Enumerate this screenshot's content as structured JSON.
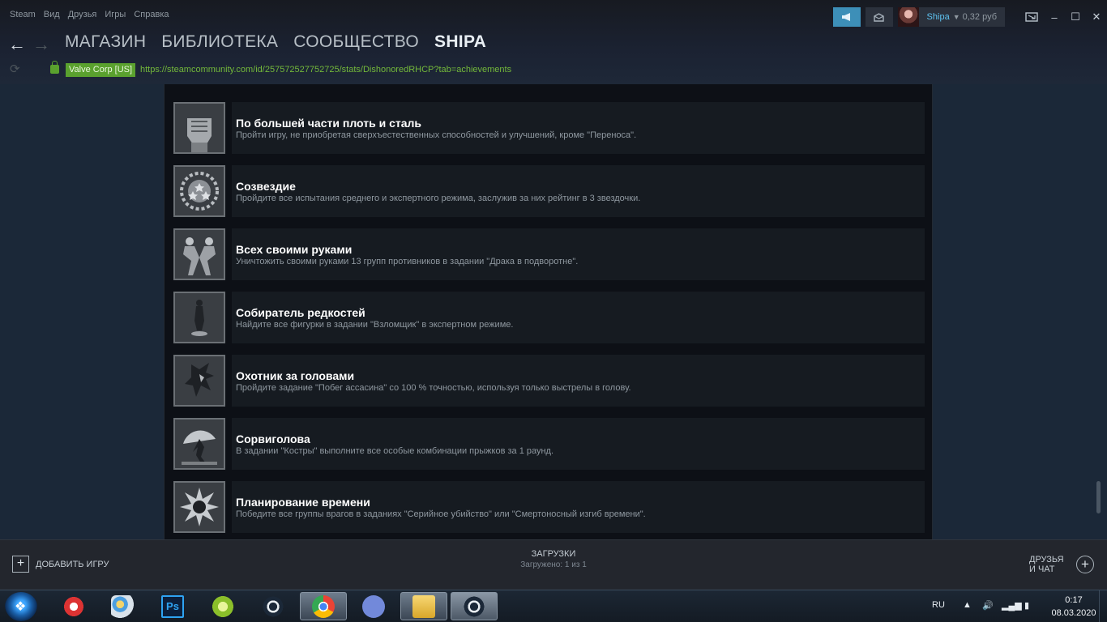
{
  "menubar": {
    "items": [
      "Steam",
      "Вид",
      "Друзья",
      "Игры",
      "Справка"
    ]
  },
  "topright": {
    "announce_icon": "megaphone-icon",
    "notify_icon": "envelope-icon",
    "account_name": "Shipa",
    "wallet": "0,32 руб",
    "big_picture_icon": "big-picture-icon",
    "window_controls": {
      "minimize": "–",
      "maximize": "☐",
      "close": "✕"
    }
  },
  "nav": {
    "back_glyph": "←",
    "forward_glyph": "→",
    "tabs": [
      "МАГАЗИН",
      "БИБЛИОТЕКА",
      "СООБЩЕСТВО",
      "SHIPA"
    ]
  },
  "url": {
    "reload_glyph": "⟳",
    "cert": "Valve Corp [US]",
    "address": "https://steamcommunity.com/id/257572527752725/stats/DishonoredRHCP?tab=achievements"
  },
  "achievements": [
    {
      "title": "По большей части плоть и сталь",
      "description": "Пройти игру, не приобретая сверхъестественных способностей и улучшений, кроме \"Переноса\".",
      "icon": "fist-icon"
    },
    {
      "title": "Созвездие",
      "description": "Пройдите все испытания среднего и экспертного режима, заслужив за них рейтинг в 3 звездочки.",
      "icon": "stars-wreath-icon"
    },
    {
      "title": "Всех своими руками",
      "description": "Уничтожить своими руками 13 групп противников в задании \"Драка в подворотне\".",
      "icon": "brawl-icon"
    },
    {
      "title": "Собиратель редкостей",
      "description": "Найдите все фигурки в задании \"Взломщик\" в экспертном режиме.",
      "icon": "figurine-icon"
    },
    {
      "title": "Охотник за головами",
      "description": "Пройдите задание \"Побег ассасина\" со 100 % точностью, используя только выстрелы в голову.",
      "icon": "assassin-icon"
    },
    {
      "title": "Сорвиголова",
      "description": "В задании \"Костры\" выполните все особые комбинации прыжков за 1 раунд.",
      "icon": "jumper-icon"
    },
    {
      "title": "Планирование времени",
      "description": "Победите все группы врагов в заданиях \"Серийное убийство\" или \"Смертоносный изгиб времени\".",
      "icon": "time-bend-icon"
    }
  ],
  "bottombar": {
    "add_game": "ДОБАВИТЬ ИГРУ",
    "downloads_title": "ЗАГРУЗКИ",
    "downloads_status": "Загружено: 1 из 1",
    "friends_line1": "ДРУЗЬЯ",
    "friends_line2": "И ЧАТ"
  },
  "taskbar": {
    "apps": [
      {
        "name": "ccleaner",
        "icon": "ccleaner-icon"
      },
      {
        "name": "paint",
        "icon": "paint-palette-icon"
      },
      {
        "name": "photoshop",
        "icon": "photoshop-icon",
        "label": "Ps"
      },
      {
        "name": "lime",
        "icon": "lime-icon"
      },
      {
        "name": "steam-pinned",
        "icon": "steam-icon"
      },
      {
        "name": "chrome",
        "icon": "chrome-icon"
      },
      {
        "name": "discord",
        "icon": "discord-icon"
      },
      {
        "name": "explorer",
        "icon": "folder-icon"
      },
      {
        "name": "steam-active",
        "icon": "steam-icon"
      }
    ],
    "language": "RU",
    "time": "0:17",
    "date": "08.03.2020"
  },
  "colors": {
    "accent_blue": "#3d8fb8",
    "link_green": "#73b83a",
    "panel": "#161b21",
    "background": "#1b2838"
  }
}
